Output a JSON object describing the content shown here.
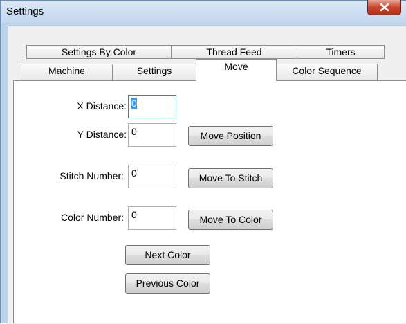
{
  "window": {
    "title": "Settings"
  },
  "tabs": {
    "row1": [
      "Settings By Color",
      "Thread Feed",
      "Timers"
    ],
    "row2": [
      "Machine",
      "Settings",
      "Move",
      "Color Sequence"
    ],
    "selected": "Move"
  },
  "move": {
    "x_distance_label": "X Distance:",
    "x_distance_value": "0",
    "y_distance_label": "Y Distance:",
    "y_distance_value": "0",
    "move_position_button": "Move Position",
    "stitch_number_label": "Stitch Number:",
    "stitch_number_value": "0",
    "move_to_stitch_button": "Move To Stitch",
    "color_number_label": "Color Number:",
    "color_number_value": "0",
    "move_to_color_button": "Move To  Color",
    "next_color_button": "Next Color",
    "previous_color_button": "Previous Color"
  },
  "colors": {
    "close_button": "#c9452b",
    "selection": "#3399ff"
  }
}
